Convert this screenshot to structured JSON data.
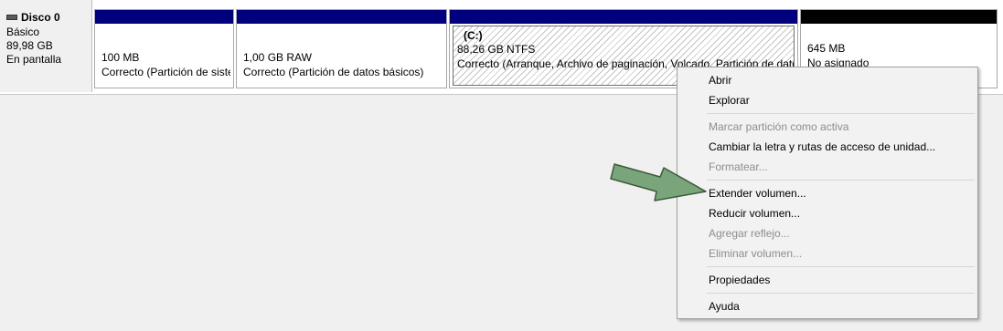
{
  "disk": {
    "title": "Disco 0",
    "type": "Básico",
    "size": "89,98 GB",
    "status": "En pantalla"
  },
  "partitions": [
    {
      "name": "",
      "size_label": "100 MB",
      "status_label": "Correcto (Partición de siste",
      "bar_color": "#00007e"
    },
    {
      "name": "",
      "size_label": "1,00 GB RAW",
      "status_label": "Correcto (Partición de datos básicos)",
      "bar_color": "#00007e"
    },
    {
      "name": "(C:)",
      "size_label": "88,26 GB NTFS",
      "status_label": "Correcto (Arranque, Archivo de paginación, Volcado, Partición de dato",
      "bar_color": "#00007e"
    },
    {
      "name": "",
      "size_label": "645 MB",
      "status_label": "No asignado",
      "bar_color": "#000000"
    }
  ],
  "context_menu": {
    "items": [
      {
        "label": "Abrir",
        "enabled": true
      },
      {
        "label": "Explorar",
        "enabled": true
      },
      {
        "label": "Marcar partición como activa",
        "enabled": false
      },
      {
        "label": "Cambiar la letra y rutas de acceso de unidad...",
        "enabled": true
      },
      {
        "label": "Formatear...",
        "enabled": false
      },
      {
        "label": "Extender volumen...",
        "enabled": true
      },
      {
        "label": "Reducir volumen...",
        "enabled": true
      },
      {
        "label": "Agregar reflejo...",
        "enabled": false
      },
      {
        "label": "Eliminar volumen...",
        "enabled": false
      },
      {
        "label": "Propiedades",
        "enabled": true
      },
      {
        "label": "Ayuda",
        "enabled": true
      }
    ]
  },
  "colors": {
    "partition_bar": "#00007e",
    "unallocated_bar": "#000000",
    "arrow_fill": "#7aa57a",
    "arrow_stroke": "#3d5a3d",
    "menu_disabled_text": "#8d8d8d"
  },
  "icons": {
    "disk": "disk-drive-icon",
    "pointer": "green-arrow-icon"
  }
}
